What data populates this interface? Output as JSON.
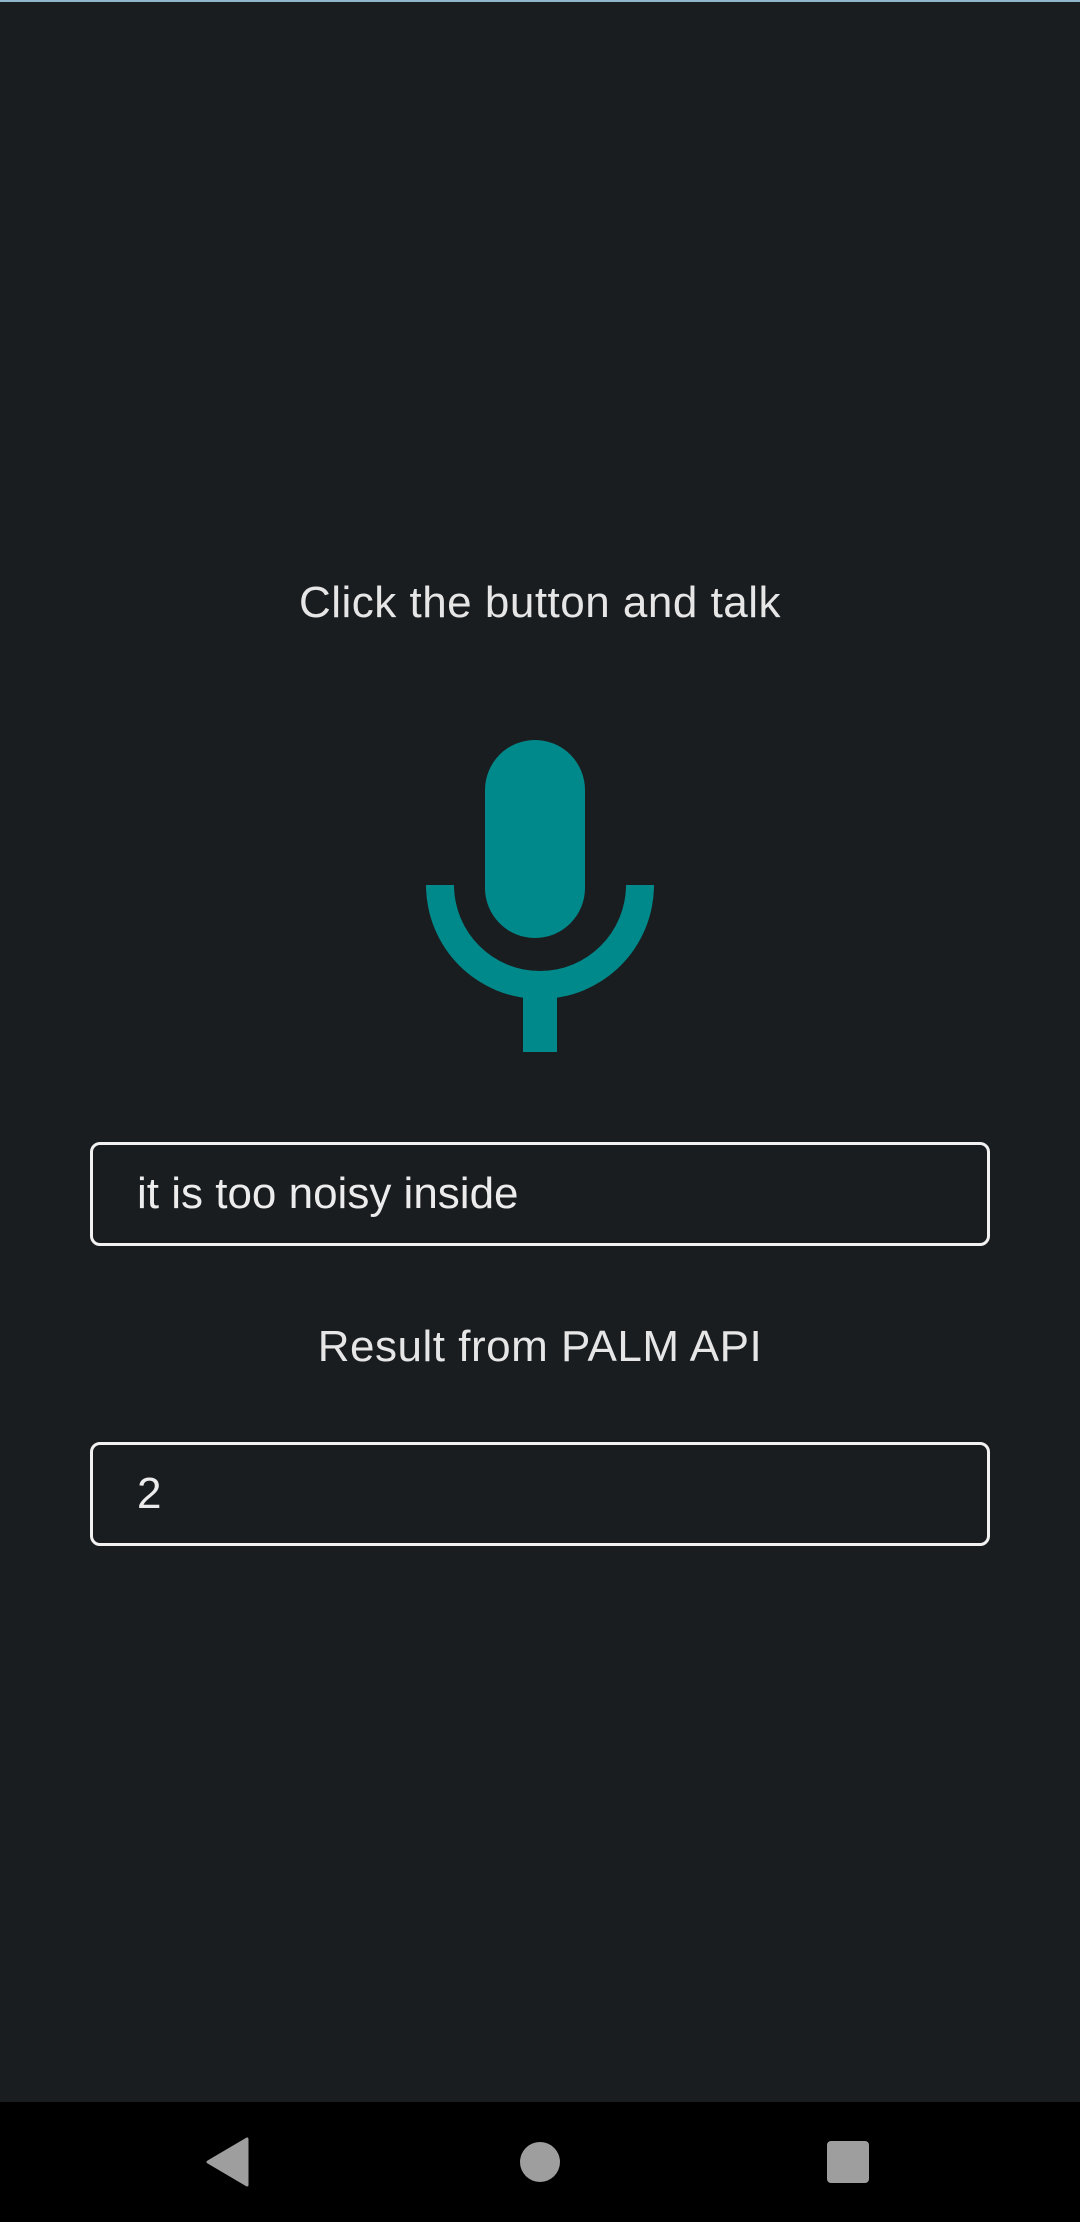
{
  "prompt": {
    "text": "Click the button and talk"
  },
  "mic": {
    "icon": "microphone-icon",
    "color": "#00898a"
  },
  "speech_field": {
    "value": "it is too noisy inside"
  },
  "result": {
    "label": "Result from PALM API",
    "value": "2"
  },
  "navigation": {
    "back_icon": "back-triangle-icon",
    "home_icon": "home-circle-icon",
    "recents_icon": "recents-square-icon",
    "icon_color": "#9e9e9e"
  }
}
